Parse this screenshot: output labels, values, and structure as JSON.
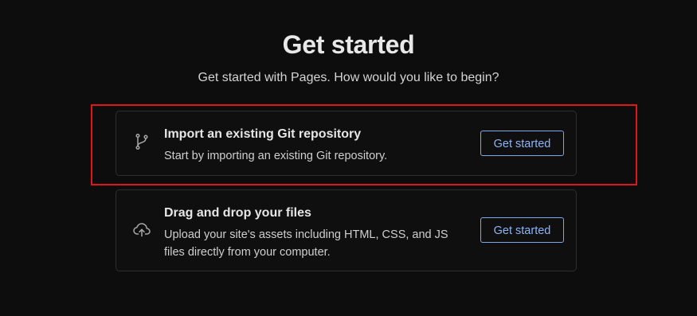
{
  "header": {
    "title": "Get started",
    "subtitle": "Get started with Pages. How would you like to begin?"
  },
  "options": [
    {
      "icon": "git-branch-icon",
      "title": "Import an existing Git repository",
      "description": "Start by importing an existing Git repository.",
      "button_label": "Get started",
      "highlighted": true
    },
    {
      "icon": "cloud-upload-icon",
      "title": "Drag and drop your files",
      "description": "Upload your site's assets including HTML, CSS, and JS files directly from your computer.",
      "button_label": "Get started",
      "highlighted": false
    }
  ],
  "colors": {
    "background": "#0d0d0d",
    "button_accent": "#8fb3f5",
    "highlight_border": "#e0161b"
  }
}
